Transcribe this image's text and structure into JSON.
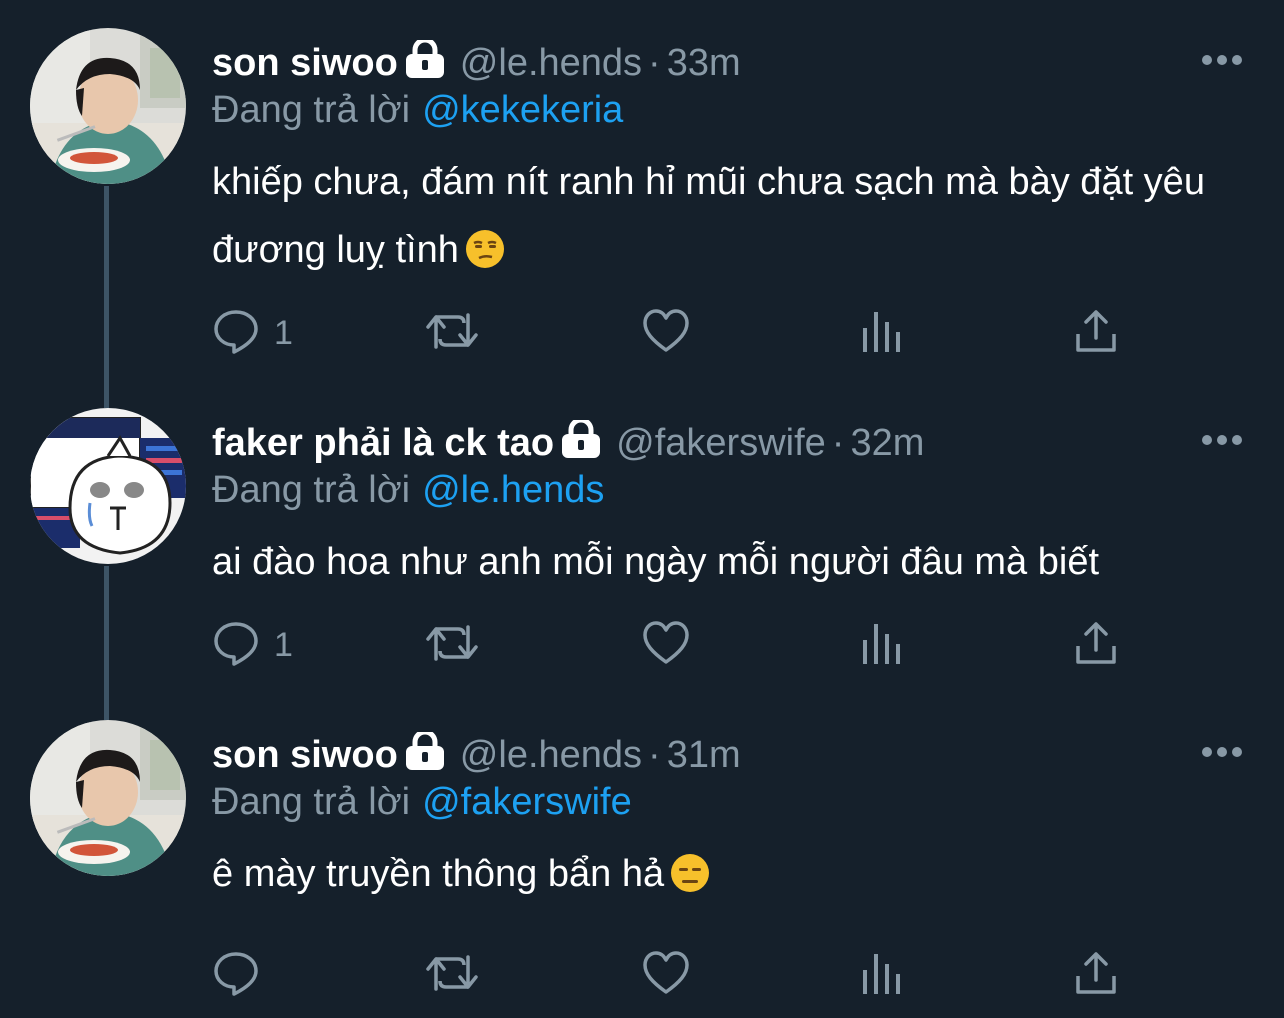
{
  "colors": {
    "background": "#15202b",
    "text_primary": "#ffffff",
    "text_secondary": "#8899a6",
    "link": "#1da1f2",
    "thread_line": "#3d5466"
  },
  "tweets": [
    {
      "name": "son siwoo",
      "locked": true,
      "handle": "@le.hends",
      "dot": "·",
      "time": "33m",
      "reply_prefix": "Đang trả lời",
      "reply_to": "@kekekeria",
      "text": "khiếp chưa, đám nít ranh hỉ mũi chưa sạch mà bày đặt yêu đương luỵ tình",
      "emoji": "unamused-face-icon",
      "reply_count": "1",
      "avatar": "photo-boy-eating-avatar"
    },
    {
      "name": "faker phải là ck tao",
      "locked": true,
      "handle": "@fakerswife",
      "dot": "·",
      "time": "32m",
      "reply_prefix": "Đang trả lời",
      "reply_to": "@le.hends",
      "text": "ai đào hoa như anh mỗi ngày mỗi người đâu mà biết",
      "emoji": "",
      "reply_count": "1",
      "avatar": "cartoon-crying-avatar"
    },
    {
      "name": "son siwoo",
      "locked": true,
      "handle": "@le.hends",
      "dot": "·",
      "time": "31m",
      "reply_prefix": "Đang trả lời",
      "reply_to": "@fakerswife",
      "text": "ê mày truyền thông bẩn hả",
      "emoji": "expressionless-face-icon",
      "reply_count": "",
      "avatar": "photo-boy-eating-avatar"
    }
  ],
  "icons": {
    "reply": "reply-bubble-icon",
    "retweet": "retweet-icon",
    "like": "heart-icon",
    "analytics": "analytics-icon",
    "share": "share-icon",
    "more": "more-dots-icon",
    "lock": "lock-icon"
  }
}
